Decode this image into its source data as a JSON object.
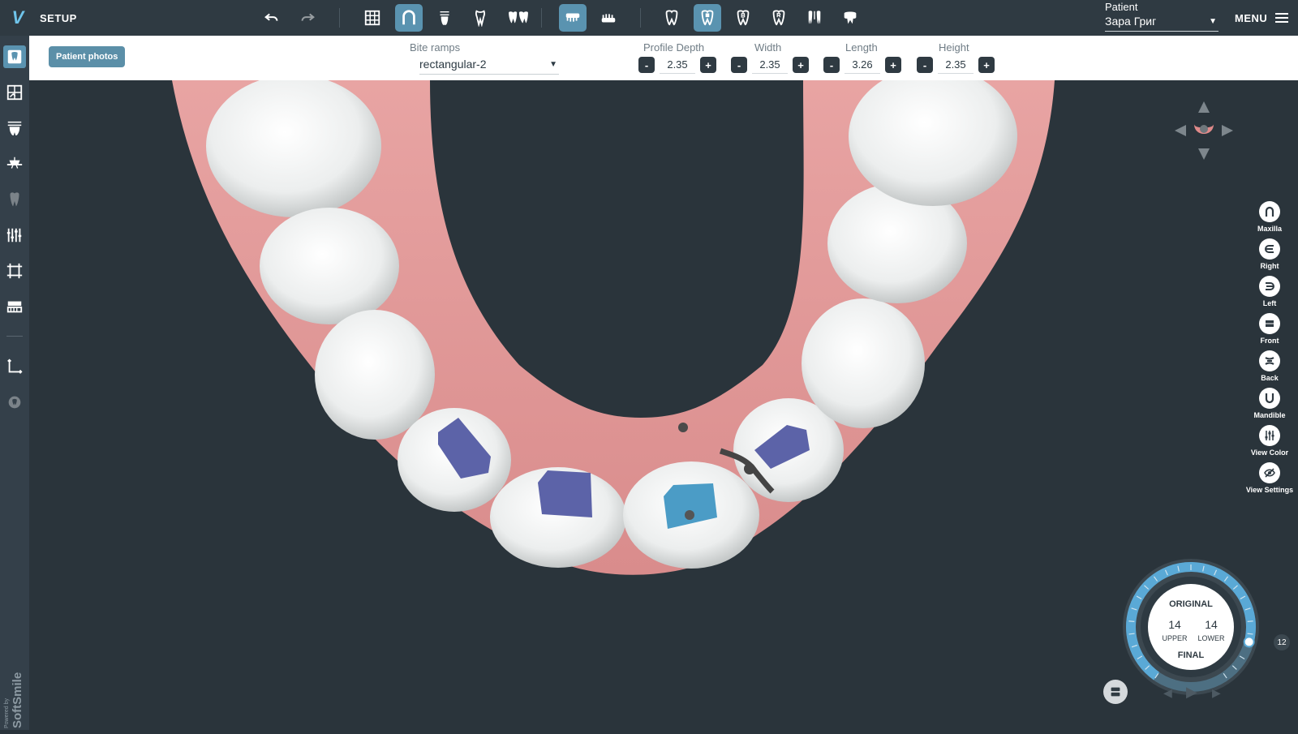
{
  "app": {
    "mode_title": "SETUP",
    "logo": "V"
  },
  "topbar": {
    "patient_label": "Patient",
    "patient_name": "Зара Григ",
    "menu_label": "MENU",
    "icons": [
      "undo-icon",
      "redo-icon",
      "grid-icon",
      "arch-icon",
      "tooth-attachment-icon",
      "tooth-roots-icon",
      "teeth-pair-icon",
      "upper-jaw-icon",
      "lower-jaw-icon",
      "tooth-icon",
      "tooth-selected-icon",
      "tooth-b-icon",
      "tooth-r-icon",
      "tooth-ipr-icon",
      "tooth-top-icon"
    ]
  },
  "subbar": {
    "patient_photos": "Patient photos",
    "bite_ramps_label": "Bite ramps",
    "bite_ramps_value": "rectangular-2",
    "steppers": [
      {
        "label": "Profile Depth",
        "value": "2.35"
      },
      {
        "label": "Width",
        "value": "2.35"
      },
      {
        "label": "Length",
        "value": "3.26"
      },
      {
        "label": "Height",
        "value": "2.35"
      }
    ],
    "minus": "-",
    "plus": "+"
  },
  "view_controls": {
    "maxilla": "Maxilla",
    "right": "Right",
    "left": "Left",
    "front": "Front",
    "back": "Back",
    "mandible": "Mandible",
    "view_color": "View Color",
    "view_settings": "View Settings"
  },
  "stage_dial": {
    "original": "ORIGINAL",
    "final": "FINAL",
    "upper_count": "14",
    "upper_label": "UPPER",
    "lower_count": "14",
    "lower_label": "LOWER",
    "current_stage": "12",
    "progress_fraction": 0.86
  },
  "sidebar": {
    "powered_by": "Powered by",
    "brand": "SoftSmile"
  },
  "colors": {
    "accent": "#5a93b0",
    "background": "#2a343b",
    "gum": "#e39a9a",
    "ramp": "#5c63a8",
    "ramp_selected": "#4b9cc6"
  }
}
